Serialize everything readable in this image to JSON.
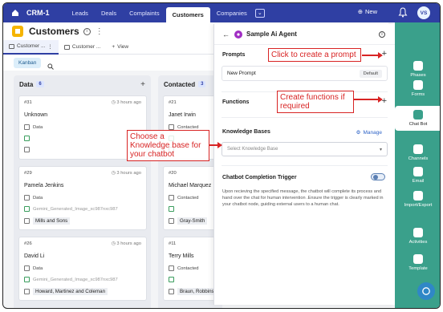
{
  "topbar": {
    "app_title": "CRM-1",
    "tabs": [
      "Leads",
      "Deals",
      "Complaints",
      "Customers",
      "Companies"
    ],
    "active_tab": "Customers",
    "new_label": "New",
    "avatar_initials": "VS"
  },
  "page": {
    "title": "Customers",
    "views": [
      {
        "label": "Customer ...",
        "active": true
      },
      {
        "label": "Customer ...",
        "active": false
      },
      {
        "label": "View",
        "active": false
      }
    ],
    "kanban_label": "Kanban"
  },
  "columns": {
    "data": {
      "title": "Data",
      "count": "6"
    },
    "contacted": {
      "title": "Contacted",
      "count": "3"
    }
  },
  "cards_data": [
    {
      "id": "#31",
      "ago": "3 hours ago",
      "name": "Unknown",
      "status": "Data",
      "file": "",
      "company": ""
    },
    {
      "id": "#29",
      "ago": "3 hours ago",
      "name": "Pamela Jenkins",
      "status": "Data",
      "file": "Gemini_Generated_Image_xc987nxc987",
      "company": "Mills and Sons"
    },
    {
      "id": "#26",
      "ago": "3 hours ago",
      "name": "David Li",
      "status": "Data",
      "file": "Gemini_Generated_Image_xc987nxc987",
      "company": "Howard, Martinez and Coleman"
    }
  ],
  "cards_contacted": [
    {
      "id": "#21",
      "name": "Janet Irwin",
      "status": "Contacted",
      "company": ""
    },
    {
      "id": "#20",
      "name": "Michael Marquez",
      "status": "Contacted",
      "company": "Gray-Smith"
    },
    {
      "id": "#11",
      "name": "Terry Mills",
      "status": "Contacted",
      "company": "Braun, Robbins"
    }
  ],
  "panel": {
    "title": "Sample Ai Agent",
    "prompts_label": "Prompts",
    "prompt_name": "New Prompt",
    "default_badge": "Default",
    "functions_label": "Functions",
    "kb_label": "Knowledge Bases",
    "manage_label": "Manage",
    "kb_placeholder": "Select Knowledge Base",
    "trigger_label": "Chatbot Completion Trigger",
    "trigger_desc": "Upon recieving the specified message, the chatbot will complete its process and hand over the chat for human intervention .Ensure the trigger is clearly marked in your chatbot node, guiding external users to a human chat."
  },
  "rightnav": {
    "items": [
      "Phases",
      "Forms",
      "Chat Bot",
      "Channels",
      "Email",
      "Import/Export",
      "Activities",
      "Template"
    ],
    "active": "Chat Bot"
  },
  "callouts": {
    "prompt": "Click to create a prompt",
    "functions": "Create functions if required",
    "kb": "Choose a Knowledge base for your chatbot"
  },
  "colors": {
    "topbar": "#2f3fa3",
    "rightnav": "#3aa08b",
    "annotation": "#d82424"
  }
}
